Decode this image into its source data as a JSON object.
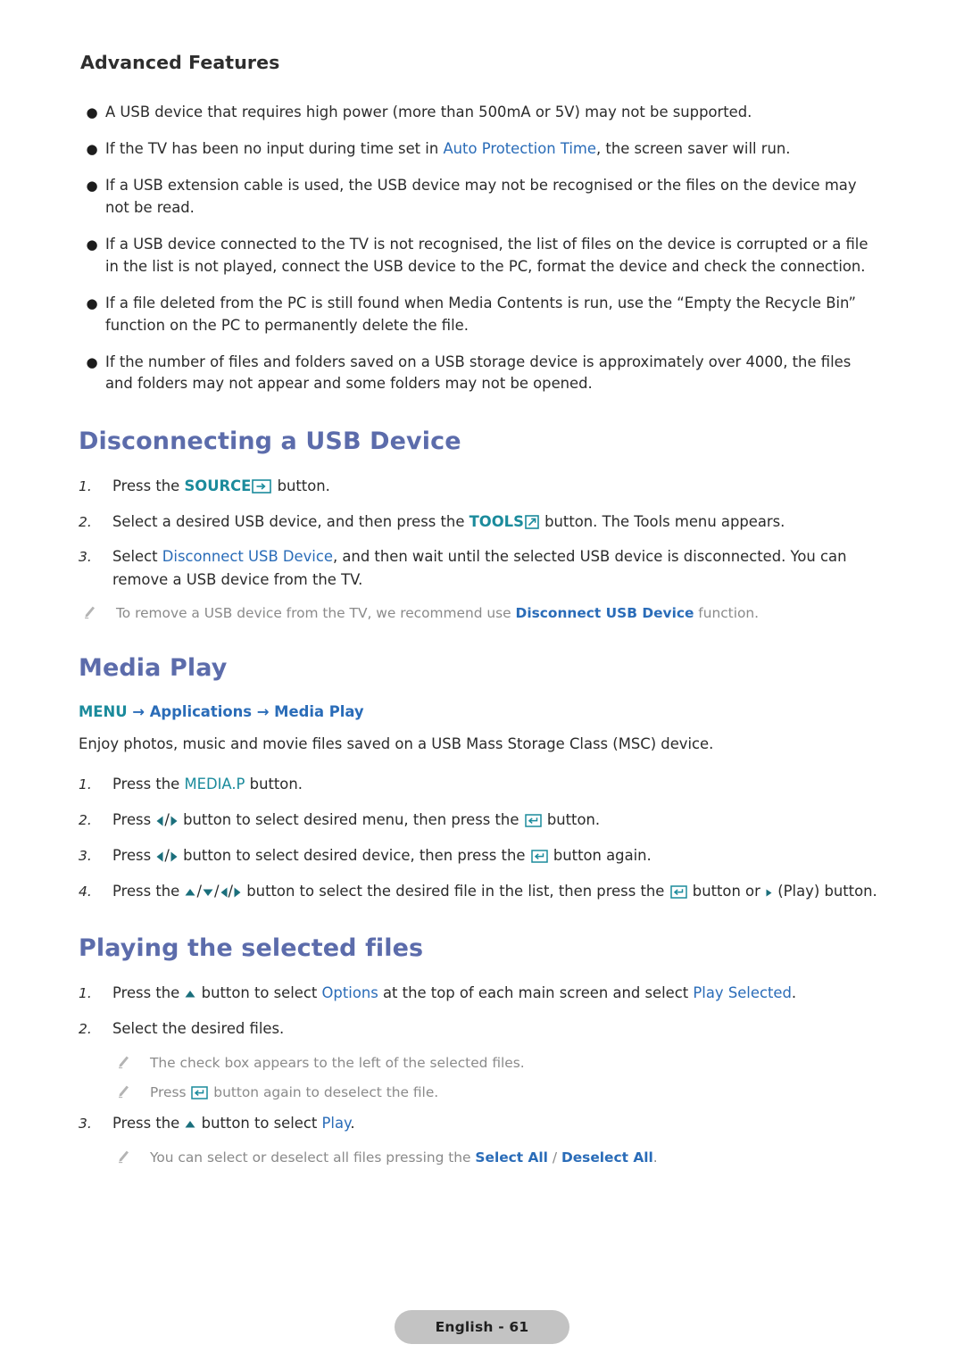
{
  "document": {
    "running_head": "Advanced Features",
    "footer_label": "English - 61"
  },
  "colors": {
    "heading": "#5c6cab",
    "link": "#2a6cb8",
    "key_teal": "#1b8b9c",
    "body": "#2b2b2b",
    "note": "#8a8a8a",
    "footer_pill_bg": "#c3c3c3"
  },
  "notes_list": {
    "items": [
      {
        "text_before": "A USB device that requires high power (more than 500mA or 5V) may not be supported.",
        "link": "",
        "text_after": ""
      },
      {
        "text_before": "If the TV has been no input during time set in ",
        "link": "Auto Protection Time",
        "text_after": ", the screen saver will run."
      },
      {
        "text_before": "If a USB extension cable is used, the USB device may not be recognised or the files on the device may not be read.",
        "link": "",
        "text_after": ""
      },
      {
        "text_before": "If a USB device connected to the TV is not recognised, the list of files on the device is corrupted or a file in the list is not played, connect the USB device to the PC, format the device and check the connection.",
        "link": "",
        "text_after": ""
      },
      {
        "text_before": "If a file deleted from the PC is still found when Media Contents is run, use the “Empty the Recycle Bin” function on the PC to permanently delete the file.",
        "link": "",
        "text_after": ""
      },
      {
        "text_before": "If the number of files and folders saved on a USB storage device is approximately over 4000, the files and folders may not appear and some folders may not be opened.",
        "link": "",
        "text_after": ""
      }
    ],
    "bullet_glyph": "●"
  },
  "disconnect_section": {
    "title": "Disconnecting a USB Device",
    "steps": [
      {
        "num": "1.",
        "pre": "Press the ",
        "key": "SOURCE",
        "icon": "source-icon",
        "post": " button."
      },
      {
        "num": "2.",
        "pre": "Select a desired USB device, and then press the ",
        "key": "TOOLS",
        "icon": "tools-icon",
        "post": " button. The Tools menu appears."
      },
      {
        "num": "3.",
        "pre": "Select ",
        "link": "Disconnect USB Device",
        "post": ", and then wait until the selected USB device is disconnected. You can remove a USB device from the TV."
      }
    ],
    "note": {
      "pre": "To remove a USB device from the TV, we recommend use ",
      "link": "Disconnect USB Device",
      "post": " function."
    }
  },
  "media_play_section": {
    "title": "Media Play",
    "breadcrumb": {
      "menu": "MENU",
      "arrow": "→",
      "item1": "Applications",
      "item2": "Media Play"
    },
    "description": "Enjoy photos, music and movie files saved on a USB Mass Storage Class (MSC) device.",
    "steps": [
      {
        "num": "1.",
        "pre": "Press the ",
        "key": "MEDIA.P",
        "post": " button."
      },
      {
        "num": "2.",
        "pre": "Press ",
        "mid": " button to select desired menu, then press the ",
        "post": " button."
      },
      {
        "num": "3.",
        "pre": "Press ",
        "mid": " button to select desired device, then press the ",
        "post": " button again."
      },
      {
        "num": "4.",
        "pre": "Press the ",
        "mid": " button to select the desired file in the list, then press the ",
        "post": " button or ",
        "tail": " (Play) button."
      }
    ]
  },
  "playing_section": {
    "title": "Playing the selected files",
    "steps": [
      {
        "num": "1.",
        "pre": "Press the ",
        "mid": " button to select ",
        "link1": "Options",
        "mid2": " at the top of each main screen and select ",
        "link2": "Play Selected",
        "post": "."
      },
      {
        "num": "2.",
        "text": "Select the desired files."
      },
      {
        "num": "3.",
        "pre": "Press the ",
        "mid": " button to select ",
        "link1": "Play",
        "post": "."
      }
    ],
    "notes": [
      {
        "text": "The check box appears to the left of the selected files."
      },
      {
        "pre": "Press ",
        "post": " button again to deselect the file."
      },
      {
        "pre": "You can select or deselect all files pressing the ",
        "link1": "Select All",
        "sep": " / ",
        "link2": "Deselect All",
        "post": "."
      }
    ]
  }
}
